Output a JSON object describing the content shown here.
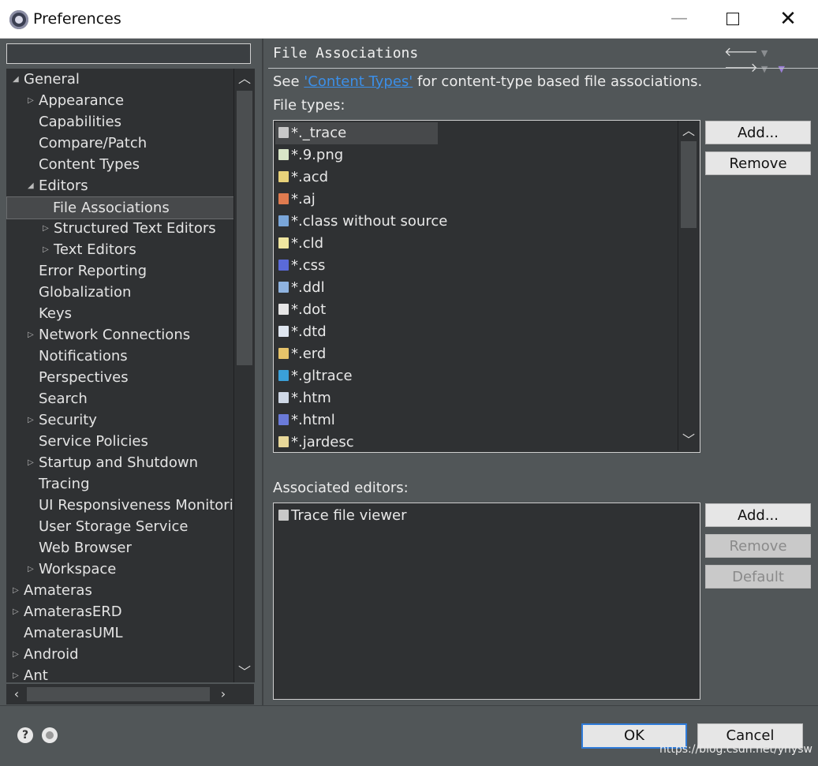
{
  "window": {
    "title": "Preferences",
    "minimize": "—",
    "close": "✕"
  },
  "filter": {
    "value": "",
    "placeholder": ""
  },
  "tree": [
    {
      "label": "General",
      "level": 0,
      "caret": "open"
    },
    {
      "label": "Appearance",
      "level": 1,
      "caret": "closed"
    },
    {
      "label": "Capabilities",
      "level": 1,
      "caret": ""
    },
    {
      "label": "Compare/Patch",
      "level": 1,
      "caret": ""
    },
    {
      "label": "Content Types",
      "level": 1,
      "caret": ""
    },
    {
      "label": "Editors",
      "level": 1,
      "caret": "open"
    },
    {
      "label": "File Associations",
      "level": 2,
      "caret": "",
      "selected": true
    },
    {
      "label": "Structured Text Editors",
      "level": 2,
      "caret": "closed"
    },
    {
      "label": "Text Editors",
      "level": 2,
      "caret": "closed"
    },
    {
      "label": "Error Reporting",
      "level": 1,
      "caret": ""
    },
    {
      "label": "Globalization",
      "level": 1,
      "caret": ""
    },
    {
      "label": "Keys",
      "level": 1,
      "caret": ""
    },
    {
      "label": "Network Connections",
      "level": 1,
      "caret": "closed"
    },
    {
      "label": "Notifications",
      "level": 1,
      "caret": ""
    },
    {
      "label": "Perspectives",
      "level": 1,
      "caret": ""
    },
    {
      "label": "Search",
      "level": 1,
      "caret": ""
    },
    {
      "label": "Security",
      "level": 1,
      "caret": "closed"
    },
    {
      "label": "Service Policies",
      "level": 1,
      "caret": ""
    },
    {
      "label": "Startup and Shutdown",
      "level": 1,
      "caret": "closed"
    },
    {
      "label": "Tracing",
      "level": 1,
      "caret": ""
    },
    {
      "label": "UI Responsiveness Monitorin",
      "level": 1,
      "caret": ""
    },
    {
      "label": "User Storage Service",
      "level": 1,
      "caret": ""
    },
    {
      "label": "Web Browser",
      "level": 1,
      "caret": ""
    },
    {
      "label": "Workspace",
      "level": 1,
      "caret": "closed"
    },
    {
      "label": "Amateras",
      "level": 0,
      "caret": "closed"
    },
    {
      "label": "AmaterasERD",
      "level": 0,
      "caret": "closed"
    },
    {
      "label": "AmaterasUML",
      "level": 0,
      "caret": ""
    },
    {
      "label": "Android",
      "level": 0,
      "caret": "closed"
    },
    {
      "label": "Ant",
      "level": 0,
      "caret": "closed"
    }
  ],
  "page": {
    "title": "File Associations",
    "see_prefix": "See ",
    "see_link": "'Content Types'",
    "see_suffix": " for content-type based file associations.",
    "file_types_label": "File types:",
    "associated_editors_label": "Associated editors:",
    "file_types": [
      {
        "name": "*._trace",
        "icon": "trace-file-icon",
        "color": "#c8c8c8",
        "selected": true
      },
      {
        "name": "*.9.png",
        "icon": "image-file-icon",
        "color": "#d9e6c8"
      },
      {
        "name": "*.acd",
        "icon": "acd-file-icon",
        "color": "#e8d27a"
      },
      {
        "name": "*.aj",
        "icon": "aspectj-file-icon",
        "color": "#e07b4f"
      },
      {
        "name": "*.class without source",
        "icon": "class-file-icon",
        "color": "#7aa6d9"
      },
      {
        "name": "*.cld",
        "icon": "cld-file-icon",
        "color": "#f0e6a0"
      },
      {
        "name": "*.css",
        "icon": "css-file-icon",
        "color": "#5a6ad9"
      },
      {
        "name": "*.ddl",
        "icon": "ddl-file-icon",
        "color": "#8fb3e0"
      },
      {
        "name": "*.dot",
        "icon": "dot-file-icon",
        "color": "#e6e6e6"
      },
      {
        "name": "*.dtd",
        "icon": "dtd-file-icon",
        "color": "#dfe6f0"
      },
      {
        "name": "*.erd",
        "icon": "erd-file-icon",
        "color": "#e6c36a"
      },
      {
        "name": "*.gltrace",
        "icon": "gltrace-file-icon",
        "color": "#3aa0d9"
      },
      {
        "name": "*.htm",
        "icon": "htm-file-icon",
        "color": "#cfd8e6"
      },
      {
        "name": "*.html",
        "icon": "html-file-icon",
        "color": "#6a7ad9"
      },
      {
        "name": "*.jardesc",
        "icon": "jardesc-file-icon",
        "color": "#e8d89a"
      }
    ],
    "editors": [
      {
        "name": "Trace file viewer",
        "icon": "trace-viewer-icon",
        "color": "#c8c8c8"
      }
    ],
    "buttons": {
      "types_add": "Add...",
      "types_remove": "Remove",
      "editors_add": "Add...",
      "editors_remove": "Remove",
      "editors_default": "Default"
    }
  },
  "footer": {
    "ok": "OK",
    "cancel": "Cancel",
    "watermark": "https://blog.csdn.net/yhysw"
  }
}
